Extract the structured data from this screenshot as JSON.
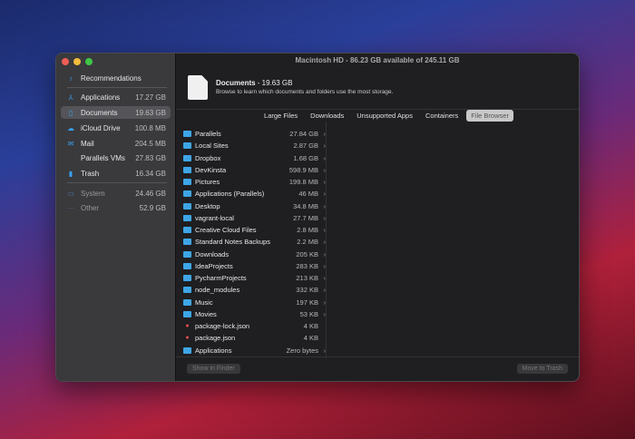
{
  "window": {
    "title": "Macintosh HD - 86.23 GB available of 245.11 GB"
  },
  "sidebar": {
    "items": [
      {
        "label": "Recommendations",
        "size": "",
        "icon": "lightbulb-icon"
      },
      {
        "label": "Applications",
        "size": "17.27 GB",
        "icon": "apps-icon"
      },
      {
        "label": "Documents",
        "size": "19.63 GB",
        "icon": "document-icon"
      },
      {
        "label": "iCloud Drive",
        "size": "100.8 MB",
        "icon": "cloud-icon"
      },
      {
        "label": "Mail",
        "size": "204.5 MB",
        "icon": "mail-icon"
      },
      {
        "label": "Parallels VMs",
        "size": "27.83 GB",
        "icon": ""
      },
      {
        "label": "Trash",
        "size": "16.34 GB",
        "icon": "trash-icon"
      },
      {
        "label": "System",
        "size": "24.46 GB",
        "icon": "laptop-icon"
      },
      {
        "label": "Other",
        "size": "52.9 GB",
        "icon": "ellipsis-icon"
      }
    ]
  },
  "header": {
    "title": "Documents",
    "size": "- 19.63 GB",
    "subtitle": "Browse to learn which documents and folders use the most storage."
  },
  "tabs": [
    "Large Files",
    "Downloads",
    "Unsupported Apps",
    "Containers",
    "File Browser"
  ],
  "files": [
    {
      "name": "Parallels",
      "size": "27.84 GB",
      "type": "folder"
    },
    {
      "name": "Local Sites",
      "size": "2.87 GB",
      "type": "folder"
    },
    {
      "name": "Dropbox",
      "size": "1.68 GB",
      "type": "folder"
    },
    {
      "name": "DevKinsta",
      "size": "598.9 MB",
      "type": "folder"
    },
    {
      "name": "Pictures",
      "size": "199.8 MB",
      "type": "folder"
    },
    {
      "name": "Applications (Parallels)",
      "size": "46 MB",
      "type": "folder"
    },
    {
      "name": "Desktop",
      "size": "34.8 MB",
      "type": "folder"
    },
    {
      "name": "vagrant-local",
      "size": "27.7 MB",
      "type": "folder"
    },
    {
      "name": "Creative Cloud Files",
      "size": "2.8 MB",
      "type": "folder"
    },
    {
      "name": "Standard Notes Backups",
      "size": "2.2 MB",
      "type": "folder"
    },
    {
      "name": "Downloads",
      "size": "205 KB",
      "type": "folder"
    },
    {
      "name": "IdeaProjects",
      "size": "283 KB",
      "type": "folder"
    },
    {
      "name": "PycharmProjects",
      "size": "213 KB",
      "type": "folder"
    },
    {
      "name": "node_modules",
      "size": "332 KB",
      "type": "folder"
    },
    {
      "name": "Music",
      "size": "197 KB",
      "type": "folder"
    },
    {
      "name": "Movies",
      "size": "53 KB",
      "type": "folder"
    },
    {
      "name": "package-lock.json",
      "size": "4 KB",
      "type": "file"
    },
    {
      "name": "package.json",
      "size": "4 KB",
      "type": "file"
    },
    {
      "name": "Applications",
      "size": "Zero bytes",
      "type": "folder"
    }
  ],
  "buttons": {
    "show_in_finder": "Show in Finder",
    "move_to_trash": "Move to Trash"
  }
}
